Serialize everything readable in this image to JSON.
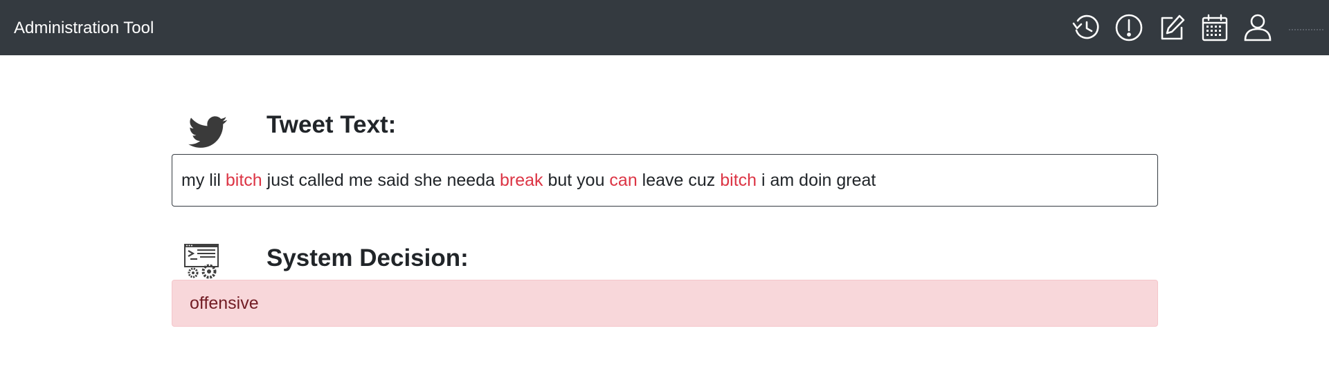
{
  "app": {
    "title": "Administration Tool"
  },
  "nav": {
    "icons": [
      "history-icon",
      "alert-icon",
      "edit-icon",
      "calendar-icon",
      "user-icon"
    ]
  },
  "tweet": {
    "heading": "Tweet Text:",
    "tokens": [
      {
        "text": "my lil ",
        "flagged": false
      },
      {
        "text": "bitch",
        "flagged": true
      },
      {
        "text": " just called me said she needa ",
        "flagged": false
      },
      {
        "text": "break",
        "flagged": true
      },
      {
        "text": " but you ",
        "flagged": false
      },
      {
        "text": "can",
        "flagged": true
      },
      {
        "text": " leave cuz ",
        "flagged": false
      },
      {
        "text": "bitch",
        "flagged": true
      },
      {
        "text": " i am doin great",
        "flagged": false
      }
    ]
  },
  "decision": {
    "heading": "System Decision:",
    "value": "offensive"
  },
  "colors": {
    "navbar": "#343a40",
    "flagged_word": "#dc3545",
    "decision_bg": "#f8d7da",
    "decision_text": "#721c24"
  }
}
